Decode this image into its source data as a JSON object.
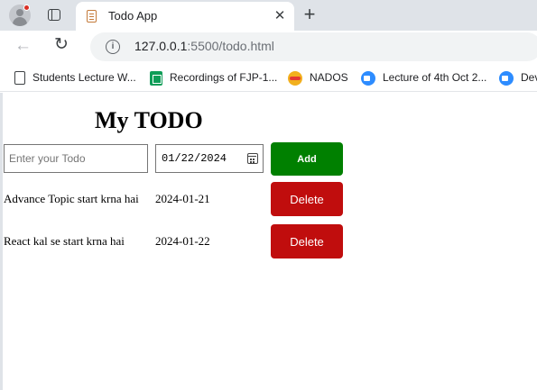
{
  "browser": {
    "tab": {
      "title": "Todo App",
      "close_glyph": "✕"
    },
    "new_tab_glyph": "+",
    "nav": {
      "back_glyph": "←",
      "reload_glyph": "↻"
    },
    "url": {
      "host": "127.0.0.1",
      "rest": ":5500/todo.html"
    },
    "bookmarks": [
      {
        "label": "Students Lecture W...",
        "icon": "document-icon"
      },
      {
        "label": "Recordings of FJP-1...",
        "icon": "google-sheets-icon"
      },
      {
        "label": "NADOS",
        "icon": "nados-icon"
      },
      {
        "label": "Lecture of 4th Oct 2...",
        "icon": "zoom-icon"
      },
      {
        "label": "Dev",
        "icon": "zoom-icon"
      }
    ]
  },
  "app": {
    "title": "My TODO",
    "todo_input": {
      "placeholder": "Enter your Todo",
      "value": ""
    },
    "date_input": {
      "value": "01/22/2024"
    },
    "add_label": "Add",
    "todos": [
      {
        "name": "Advance Topic start krna hai",
        "date": "2024-01-21",
        "delete_label": "Delete"
      },
      {
        "name": "React kal se start krna hai",
        "date": "2024-01-22",
        "delete_label": "Delete"
      }
    ]
  },
  "colors": {
    "add_button": "#008000",
    "delete_button": "#c00d0d"
  }
}
